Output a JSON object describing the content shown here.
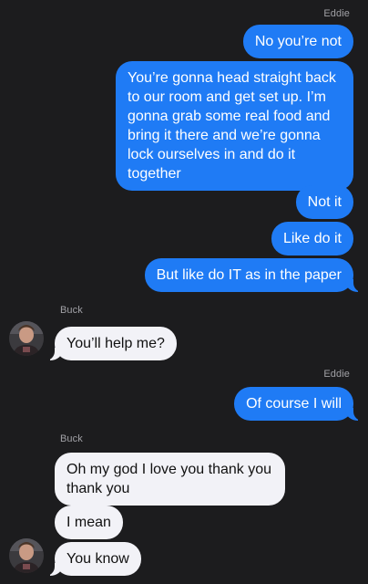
{
  "contacts": {
    "right_name": "Eddie",
    "left_name": "Buck"
  },
  "messages": [
    {
      "from": "Eddie",
      "text": "No you’re not"
    },
    {
      "from": "Eddie",
      "text": "You’re gonna head straight back to our room and get set up. I’m gonna grab some real food and bring it there and we’re gonna lock ourselves in and do it together"
    },
    {
      "from": "Eddie",
      "text": "Not it"
    },
    {
      "from": "Eddie",
      "text": "Like do it"
    },
    {
      "from": "Eddie",
      "text": "But like do IT as in the paper"
    },
    {
      "from": "Buck",
      "text": "You’ll help me?"
    },
    {
      "from": "Eddie",
      "text": "Of course I will"
    },
    {
      "from": "Buck",
      "text": "Oh my god I love you thank you thank you"
    },
    {
      "from": "Buck",
      "text": "I mean"
    },
    {
      "from": "Buck",
      "text": "You know"
    }
  ],
  "icons": {
    "avatar": "contact-photo-avatar"
  },
  "colors": {
    "background": "#1c1c1e",
    "outgoing_bubble": "#1f7bf5",
    "incoming_bubble": "#f2f2f7",
    "sender_name": "#a1a1a6"
  }
}
